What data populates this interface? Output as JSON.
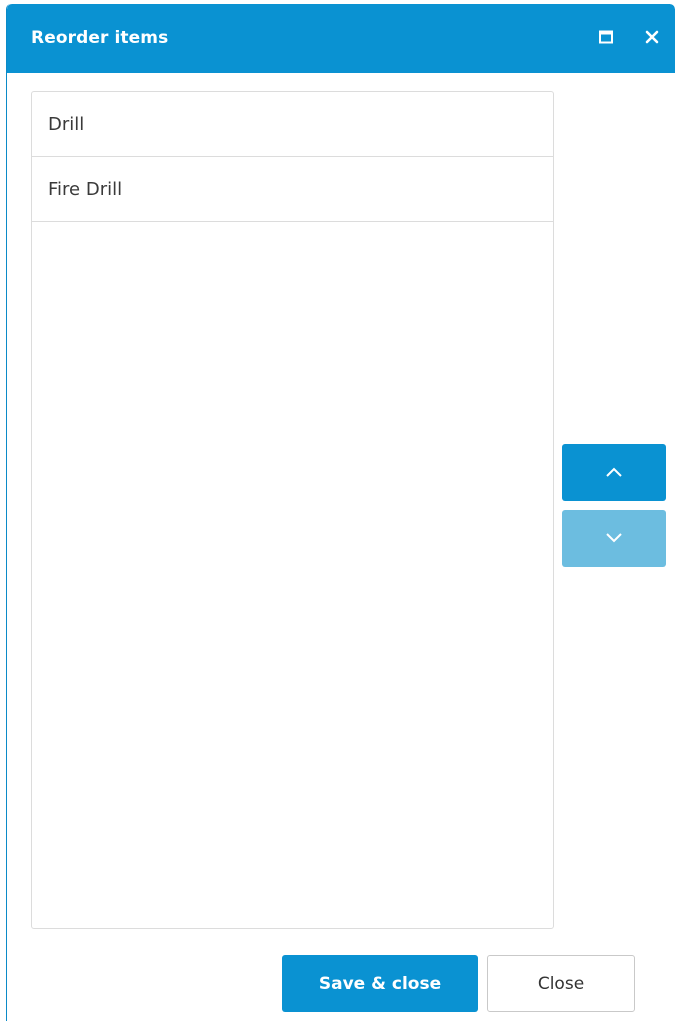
{
  "dialog": {
    "title": "Reorder items",
    "maximize_icon": "maximize-icon",
    "close_icon": "close-icon"
  },
  "list": {
    "items": [
      {
        "label": "Drill"
      },
      {
        "label": "Fire Drill"
      }
    ]
  },
  "move": {
    "up_icon": "chevron-up-icon",
    "down_icon": "chevron-down-icon"
  },
  "footer": {
    "save_label": "Save & close",
    "close_label": "Close"
  },
  "colors": {
    "accent": "#0a92d2",
    "accent_disabled": "#6cbde0",
    "border": "#dcdcdc"
  }
}
